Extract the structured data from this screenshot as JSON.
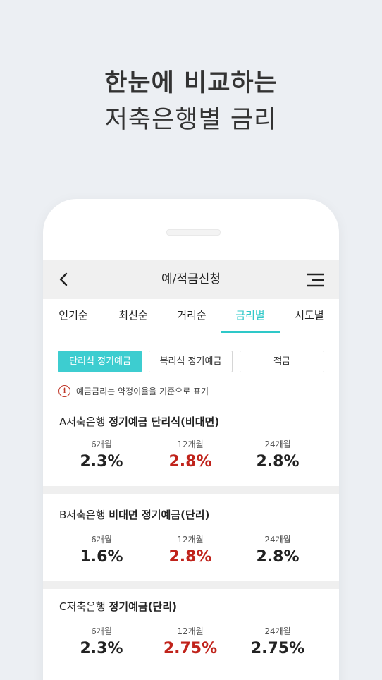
{
  "headline": {
    "line1": "한눈에 비교하는",
    "line2": "저축은행별 금리"
  },
  "appbar": {
    "title": "예/적금신청",
    "back_icon": "chevron-left-icon",
    "menu_icon": "hamburger-menu-icon"
  },
  "tabs": [
    {
      "label": "인기순",
      "active": false
    },
    {
      "label": "최신순",
      "active": false
    },
    {
      "label": "거리순",
      "active": false
    },
    {
      "label": "금리별",
      "active": true
    },
    {
      "label": "시도별",
      "active": false
    }
  ],
  "filters": [
    {
      "label": "단리식 정기예금",
      "active": true
    },
    {
      "label": "복리식 정기예금",
      "active": false
    },
    {
      "label": "적금",
      "active": false
    }
  ],
  "notice": {
    "icon": "info-icon",
    "icon_glyph": "i",
    "text": "예금금리는 약정이율을 기준으로 표기"
  },
  "cards": [
    {
      "bank": "A저축은행",
      "product": "정기예금 단리식(비대면)",
      "rates": [
        {
          "period": "6개월",
          "value": "2.3%",
          "highlight": false
        },
        {
          "period": "12개월",
          "value": "2.8%",
          "highlight": true
        },
        {
          "period": "24개월",
          "value": "2.8%",
          "highlight": false
        }
      ]
    },
    {
      "bank": "B저축은행",
      "product": "비대면 정기예금(단리)",
      "rates": [
        {
          "period": "6개월",
          "value": "1.6%",
          "highlight": false
        },
        {
          "period": "12개월",
          "value": "2.8%",
          "highlight": true
        },
        {
          "period": "24개월",
          "value": "2.8%",
          "highlight": false
        }
      ]
    },
    {
      "bank": "C저축은행",
      "product": "정기예금(단리)",
      "rates": [
        {
          "period": "6개월",
          "value": "2.3%",
          "highlight": false
        },
        {
          "period": "12개월",
          "value": "2.75%",
          "highlight": true
        },
        {
          "period": "24개월",
          "value": "2.75%",
          "highlight": false
        }
      ]
    }
  ],
  "colors": {
    "accent": "#2ec8c8",
    "highlight": "#c0231b",
    "background": "#eceff3"
  }
}
